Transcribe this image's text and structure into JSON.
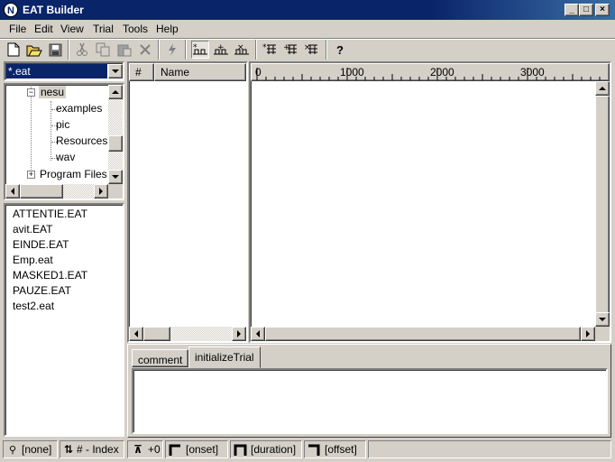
{
  "window": {
    "title": "EAT Builder",
    "icon_letter": "N"
  },
  "caption_buttons": {
    "minimize": "_",
    "maximize": "□",
    "close": "×"
  },
  "menu": [
    "File",
    "Edit",
    "View",
    "Trial",
    "Tools",
    "Help"
  ],
  "menu_accel": [
    "F",
    "E",
    "V",
    "T",
    "T",
    "H"
  ],
  "toolbar": {
    "icons": [
      "new-icon",
      "open-icon",
      "save-icon",
      "cut-icon",
      "copy-icon",
      "paste-icon",
      "delete-icon",
      "run-icon",
      "event-view-icon",
      "add-event-icon",
      "remove-event-icon",
      "insert-trial-icon",
      "add-trial-icon",
      "remove-trial-icon",
      "help-icon"
    ],
    "help_label": "?"
  },
  "filter": {
    "value": "*.eat"
  },
  "tree": {
    "items": [
      {
        "label": "nesu",
        "expander": "⊟",
        "selected": true
      },
      {
        "label": "examples"
      },
      {
        "label": "pic"
      },
      {
        "label": "Resources"
      },
      {
        "label": "wav"
      },
      {
        "label": "Program Files",
        "expander": "⊞"
      }
    ]
  },
  "files": [
    "ATTENTIE.EAT",
    "avit.EAT",
    "EINDE.EAT",
    "Emp.eat",
    "MASKED1.EAT",
    "PAUZE.EAT",
    "test2.eat"
  ],
  "trial_list": {
    "col_index": "#",
    "col_name": "Name"
  },
  "timeline": {
    "ticks": [
      "0",
      "1000",
      "2000",
      "3000"
    ]
  },
  "tabs": [
    "comment",
    "initializeTrial"
  ],
  "active_tab": "initializeTrial",
  "status": {
    "none_label": "[none]",
    "sort_label": "# - Index",
    "offset_value": "+0",
    "onset_label": "[onset]",
    "duration_label": "[duration]",
    "offset_label": "[offset]"
  },
  "colors": {
    "title_bar": "#0a246a",
    "selection": "#0a246a",
    "face": "#d4d0c8"
  }
}
